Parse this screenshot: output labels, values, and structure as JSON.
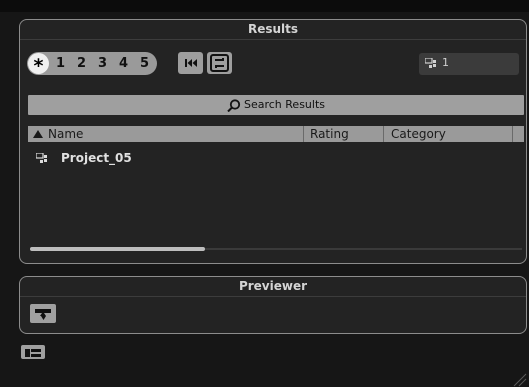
{
  "results_panel": {
    "title": "Results",
    "rating_filter": {
      "all_symbol": "*",
      "levels": [
        "1",
        "2",
        "3",
        "4",
        "5"
      ]
    },
    "icons": {
      "rewind": "skip-to-start-icon",
      "sync": "sync-icon"
    },
    "result_count": "1",
    "search_label": "Search Results",
    "columns": [
      "Name",
      "Rating",
      "Category"
    ],
    "rows": [
      {
        "name": "Project_05",
        "icon": "project-icon"
      }
    ]
  },
  "previewer_panel": {
    "title": "Previewer",
    "icon": "preview-icon"
  },
  "layout_icon": "layout-toggle-icon",
  "colors": {
    "background": "#161616",
    "panel": "#232323",
    "border": "#8c8c8c",
    "button": "#9e9e9e",
    "header": "#9a9a9a"
  }
}
